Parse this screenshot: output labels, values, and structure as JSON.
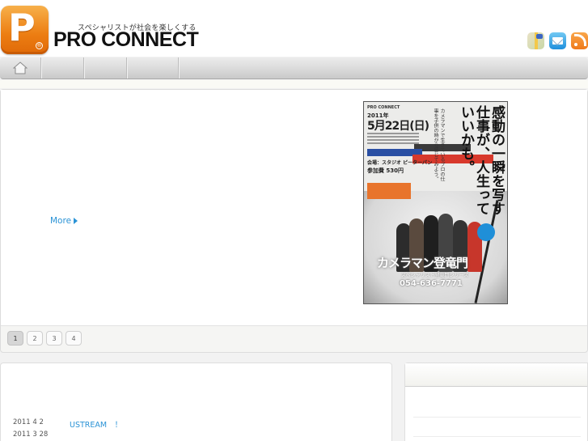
{
  "header": {
    "logo_letter": "P",
    "logo_mark": "®",
    "tagline": "スペシャリストが社会を楽しくする",
    "brand": "PRO CONNECT",
    "icons": [
      "map-icon",
      "mail-icon",
      "rss-icon"
    ]
  },
  "nav": {
    "items": [
      {
        "icon": "home-icon",
        "label": ""
      },
      {
        "label": ""
      },
      {
        "label": ""
      },
      {
        "label": ""
      }
    ]
  },
  "feature": {
    "more_label": "More",
    "poster": {
      "brand": "PRO CONNECT",
      "year": "2011年",
      "date": "5月22日(日)",
      "venue": "会場：スタジオ ピーターパン",
      "fee": "参加費 530円",
      "headline": "感動の一瞬を写す仕事が、人生っていいかも。",
      "subline": "カメラマンで生きているプロの仕事を子供の時から感じてみよう。",
      "title": "カメラマン登竜門",
      "series": "スペシャリスト登竜門シリーズ",
      "phone": "054-636-7771"
    },
    "pager": {
      "pages": [
        "1",
        "2",
        "3",
        "4"
      ],
      "active": "1"
    }
  },
  "news": {
    "items": [
      {
        "date": "2011 4 2",
        "title": "USTREAM　！"
      },
      {
        "date": "2011 3 28",
        "title": ""
      }
    ]
  },
  "colors": {
    "accent_blue": "#2b93d6",
    "logo_orange": "#ec7d12"
  }
}
